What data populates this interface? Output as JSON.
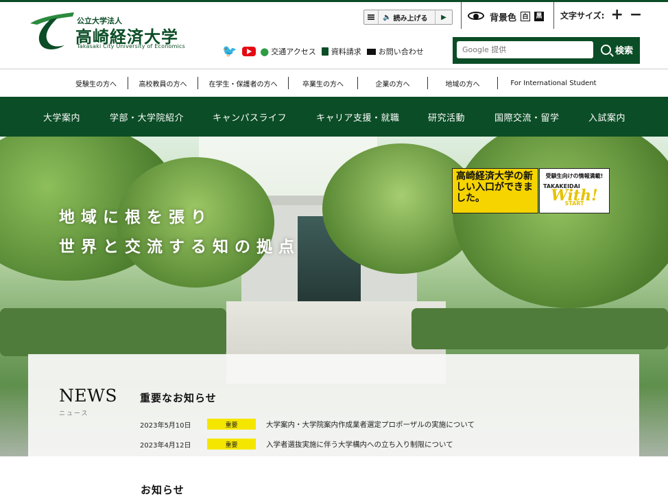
{
  "header": {
    "logo_sub": "公立大学法人",
    "logo_title": "高崎経済大学",
    "logo_en": "Takasaki City University of Economics",
    "read_aloud_label": "読み上げる",
    "bg_color_label": "背景色",
    "bg_white": "白",
    "bg_black": "黒",
    "font_size_label": "文字サイズ:",
    "font_plus": "+",
    "font_minus": "−",
    "links": {
      "access": "交通アクセス",
      "brochure": "資料請求",
      "contact": "お問い合わせ"
    },
    "search": {
      "placeholder": "Google 提供",
      "button_label": "検索"
    }
  },
  "audience_nav": [
    "受験生の方へ",
    "高校教員の方へ",
    "在学生・保護者の方へ",
    "卒業生の方へ",
    "企業の方へ",
    "地域の方へ",
    "For International Student"
  ],
  "global_nav": [
    "大学案内",
    "学部・大学院紹介",
    "キャンパスライフ",
    "キャリア支援・就職",
    "研究活動",
    "国際交流・留学",
    "入試案内"
  ],
  "hero": {
    "catch_line1": "地域に根を張り",
    "catch_line2": "世界と交流する知の拠点",
    "banner_left": "高崎経済大学の新しい入口ができました。",
    "banner_right_top": "受験生向けの情報満載!",
    "banner_right_brand": "TAKAKEIDAI",
    "banner_right_with": "With!",
    "banner_right_start": "START"
  },
  "news": {
    "title": "NEWS",
    "subtitle": "ニュース",
    "important_heading": "重要なお知らせ",
    "items": [
      {
        "date": "2023年5月10日",
        "badge": "重要",
        "text": "大学案内・大学院案内作成業者選定プロポーザルの実施について"
      },
      {
        "date": "2023年4月12日",
        "badge": "重要",
        "text": "入学者選抜実施に伴う大学構内への立ち入り制限について"
      }
    ],
    "notice_heading": "お知らせ"
  },
  "colors": {
    "brand_green": "#0b4d26",
    "badge_yellow": "#f5e600",
    "banner_yellow": "#f5d400"
  }
}
